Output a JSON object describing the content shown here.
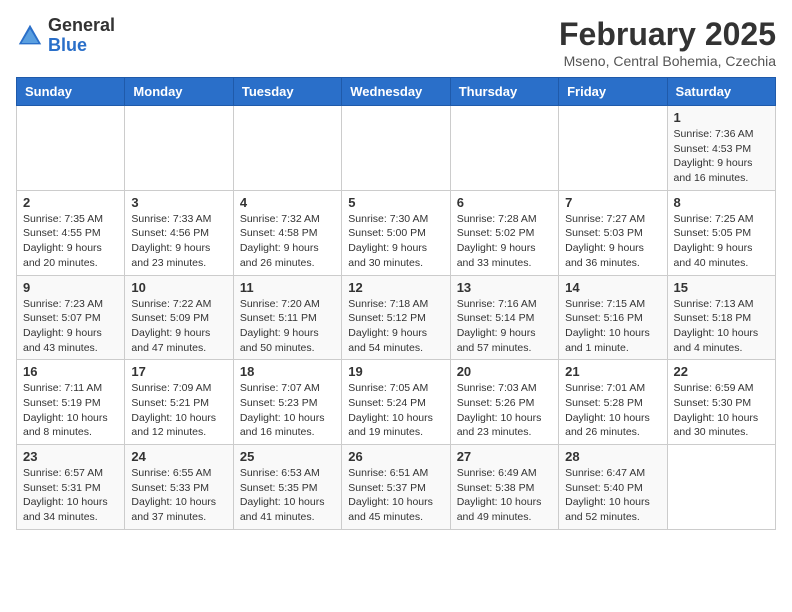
{
  "header": {
    "logo_general": "General",
    "logo_blue": "Blue",
    "month_title": "February 2025",
    "subtitle": "Mseno, Central Bohemia, Czechia"
  },
  "days_of_week": [
    "Sunday",
    "Monday",
    "Tuesday",
    "Wednesday",
    "Thursday",
    "Friday",
    "Saturday"
  ],
  "weeks": [
    [
      {
        "day": "",
        "info": ""
      },
      {
        "day": "",
        "info": ""
      },
      {
        "day": "",
        "info": ""
      },
      {
        "day": "",
        "info": ""
      },
      {
        "day": "",
        "info": ""
      },
      {
        "day": "",
        "info": ""
      },
      {
        "day": "1",
        "info": "Sunrise: 7:36 AM\nSunset: 4:53 PM\nDaylight: 9 hours and 16 minutes."
      }
    ],
    [
      {
        "day": "2",
        "info": "Sunrise: 7:35 AM\nSunset: 4:55 PM\nDaylight: 9 hours and 20 minutes."
      },
      {
        "day": "3",
        "info": "Sunrise: 7:33 AM\nSunset: 4:56 PM\nDaylight: 9 hours and 23 minutes."
      },
      {
        "day": "4",
        "info": "Sunrise: 7:32 AM\nSunset: 4:58 PM\nDaylight: 9 hours and 26 minutes."
      },
      {
        "day": "5",
        "info": "Sunrise: 7:30 AM\nSunset: 5:00 PM\nDaylight: 9 hours and 30 minutes."
      },
      {
        "day": "6",
        "info": "Sunrise: 7:28 AM\nSunset: 5:02 PM\nDaylight: 9 hours and 33 minutes."
      },
      {
        "day": "7",
        "info": "Sunrise: 7:27 AM\nSunset: 5:03 PM\nDaylight: 9 hours and 36 minutes."
      },
      {
        "day": "8",
        "info": "Sunrise: 7:25 AM\nSunset: 5:05 PM\nDaylight: 9 hours and 40 minutes."
      }
    ],
    [
      {
        "day": "9",
        "info": "Sunrise: 7:23 AM\nSunset: 5:07 PM\nDaylight: 9 hours and 43 minutes."
      },
      {
        "day": "10",
        "info": "Sunrise: 7:22 AM\nSunset: 5:09 PM\nDaylight: 9 hours and 47 minutes."
      },
      {
        "day": "11",
        "info": "Sunrise: 7:20 AM\nSunset: 5:11 PM\nDaylight: 9 hours and 50 minutes."
      },
      {
        "day": "12",
        "info": "Sunrise: 7:18 AM\nSunset: 5:12 PM\nDaylight: 9 hours and 54 minutes."
      },
      {
        "day": "13",
        "info": "Sunrise: 7:16 AM\nSunset: 5:14 PM\nDaylight: 9 hours and 57 minutes."
      },
      {
        "day": "14",
        "info": "Sunrise: 7:15 AM\nSunset: 5:16 PM\nDaylight: 10 hours and 1 minute."
      },
      {
        "day": "15",
        "info": "Sunrise: 7:13 AM\nSunset: 5:18 PM\nDaylight: 10 hours and 4 minutes."
      }
    ],
    [
      {
        "day": "16",
        "info": "Sunrise: 7:11 AM\nSunset: 5:19 PM\nDaylight: 10 hours and 8 minutes."
      },
      {
        "day": "17",
        "info": "Sunrise: 7:09 AM\nSunset: 5:21 PM\nDaylight: 10 hours and 12 minutes."
      },
      {
        "day": "18",
        "info": "Sunrise: 7:07 AM\nSunset: 5:23 PM\nDaylight: 10 hours and 16 minutes."
      },
      {
        "day": "19",
        "info": "Sunrise: 7:05 AM\nSunset: 5:24 PM\nDaylight: 10 hours and 19 minutes."
      },
      {
        "day": "20",
        "info": "Sunrise: 7:03 AM\nSunset: 5:26 PM\nDaylight: 10 hours and 23 minutes."
      },
      {
        "day": "21",
        "info": "Sunrise: 7:01 AM\nSunset: 5:28 PM\nDaylight: 10 hours and 26 minutes."
      },
      {
        "day": "22",
        "info": "Sunrise: 6:59 AM\nSunset: 5:30 PM\nDaylight: 10 hours and 30 minutes."
      }
    ],
    [
      {
        "day": "23",
        "info": "Sunrise: 6:57 AM\nSunset: 5:31 PM\nDaylight: 10 hours and 34 minutes."
      },
      {
        "day": "24",
        "info": "Sunrise: 6:55 AM\nSunset: 5:33 PM\nDaylight: 10 hours and 37 minutes."
      },
      {
        "day": "25",
        "info": "Sunrise: 6:53 AM\nSunset: 5:35 PM\nDaylight: 10 hours and 41 minutes."
      },
      {
        "day": "26",
        "info": "Sunrise: 6:51 AM\nSunset: 5:37 PM\nDaylight: 10 hours and 45 minutes."
      },
      {
        "day": "27",
        "info": "Sunrise: 6:49 AM\nSunset: 5:38 PM\nDaylight: 10 hours and 49 minutes."
      },
      {
        "day": "28",
        "info": "Sunrise: 6:47 AM\nSunset: 5:40 PM\nDaylight: 10 hours and 52 minutes."
      },
      {
        "day": "",
        "info": ""
      }
    ]
  ]
}
